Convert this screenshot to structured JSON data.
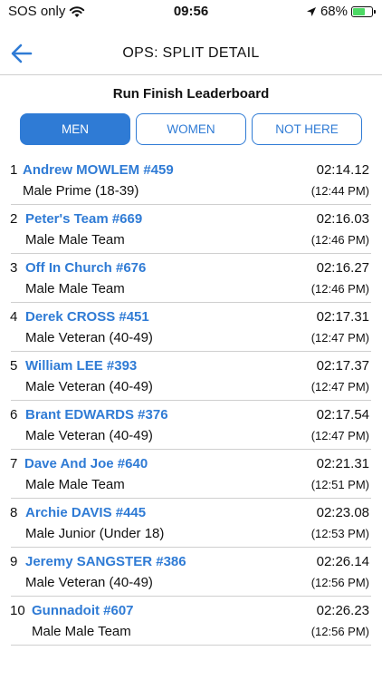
{
  "status": {
    "carrier": "SOS only",
    "time": "09:56",
    "battery": "68%",
    "battery_level": 0.68
  },
  "nav": {
    "title": "OPS: SPLIT DETAIL",
    "back_icon": "arrow-left-icon"
  },
  "leaderboard_title": "Run Finish Leaderboard",
  "tabs": [
    {
      "label": "MEN",
      "active": true
    },
    {
      "label": "WOMEN",
      "active": false
    },
    {
      "label": "NOT HERE",
      "active": false
    }
  ],
  "entries": [
    {
      "rank": "1",
      "name": "Andrew MOWLEM #459",
      "category": "Male Prime (18-39)",
      "split": "02:14.12",
      "clock": "(12:44 PM)"
    },
    {
      "rank": "2",
      "name": "Peter's Team  #669",
      "category": "Male Male Team",
      "split": "02:16.03",
      "clock": "(12:46 PM)"
    },
    {
      "rank": "3",
      "name": "Off In Church  #676",
      "category": "Male Male Team",
      "split": "02:16.27",
      "clock": "(12:46 PM)"
    },
    {
      "rank": "4",
      "name": "Derek CROSS #451",
      "category": "Male Veteran (40-49)",
      "split": "02:17.31",
      "clock": "(12:47 PM)"
    },
    {
      "rank": "5",
      "name": "William LEE #393",
      "category": "Male Veteran (40-49)",
      "split": "02:17.37",
      "clock": "(12:47 PM)"
    },
    {
      "rank": "6",
      "name": "Brant EDWARDS #376",
      "category": "Male Veteran (40-49)",
      "split": "02:17.54",
      "clock": "(12:47 PM)"
    },
    {
      "rank": "7",
      "name": "Dave And Joe  #640",
      "category": "Male Male Team",
      "split": "02:21.31",
      "clock": "(12:51 PM)"
    },
    {
      "rank": "8",
      "name": "Archie DAVIS #445",
      "category": "Male Junior (Under 18)",
      "split": "02:23.08",
      "clock": "(12:53 PM)"
    },
    {
      "rank": "9",
      "name": "Jeremy SANGSTER #386",
      "category": "Male Veteran (40-49)",
      "split": "02:26.14",
      "clock": "(12:56 PM)"
    },
    {
      "rank": "10",
      "name": "Gunnadoit  #607",
      "category": "Male Male Team",
      "split": "02:26.23",
      "clock": "(12:56 PM)"
    }
  ],
  "colors": {
    "accent": "#2f7bd5",
    "divider": "#cfcfcf",
    "battery": "#4cd964"
  }
}
